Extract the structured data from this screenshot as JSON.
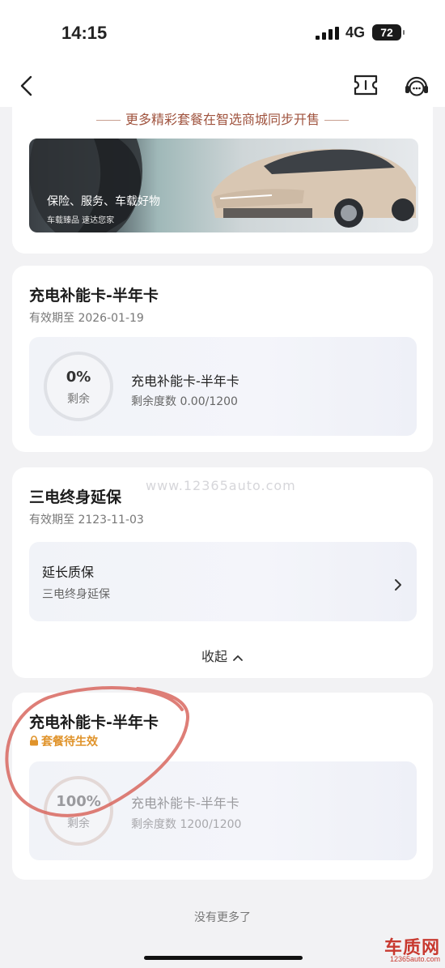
{
  "status_bar": {
    "time": "14:15",
    "network": "4G",
    "battery": "72"
  },
  "nav": {
    "back_icon": "chevron-left-icon",
    "ticket_icon": "ticket-icon",
    "service_icon": "customer-service-icon"
  },
  "promo": {
    "heading": "更多精彩套餐在智选商城同步开售",
    "banner_text": "保险、服务、车载好物",
    "banner_subtext": "车载臻品 速达您家"
  },
  "packages": [
    {
      "title": "充电补能卡-半年卡",
      "validity": "有效期至 2026-01-19",
      "ring_percent": "0%",
      "ring_label": "剩余",
      "item_title": "充电补能卡-半年卡",
      "item_remaining": "剩余度数 0.00/1200"
    },
    {
      "title": "三电终身延保",
      "validity": "有效期至 2123-11-03",
      "item_title": "延长质保",
      "item_sub": "三电终身延保",
      "collapse_label": "收起"
    },
    {
      "title": "充电补能卡-半年卡",
      "status": "套餐待生效",
      "ring_percent": "100%",
      "ring_label": "剩余",
      "item_title": "充电补能卡-半年卡",
      "item_remaining": "剩余度数 1200/1200"
    }
  ],
  "footer": {
    "no_more": "没有更多了"
  },
  "watermark": "www.12365auto.com",
  "logo": {
    "main": "车质网",
    "sub": "12365auto.com"
  },
  "colors": {
    "accent_promo": "#a0543f",
    "pending": "#e0932a",
    "annotation": "#d8675f",
    "logo": "#c83a30"
  }
}
